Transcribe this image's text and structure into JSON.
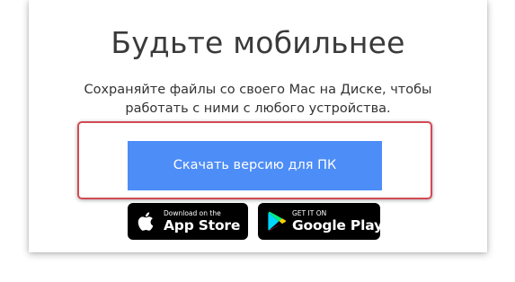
{
  "promo": {
    "headline": "Будьте мобильнее",
    "subtitle": "Сохраняйте файлы со своего Mac на Диске, чтобы работать с ними с любого устройства.",
    "download_button_label": "Скачать версию для ПК",
    "accent_color": "#4d8df7",
    "highlight_color": "#d24a55"
  },
  "badges": {
    "app_store": {
      "small_text": "Download on the",
      "big_text": "App Store",
      "icon": "apple-icon"
    },
    "google_play": {
      "small_text": "GET IT ON",
      "big_text": "Google Play",
      "icon": "google-play-icon"
    }
  }
}
